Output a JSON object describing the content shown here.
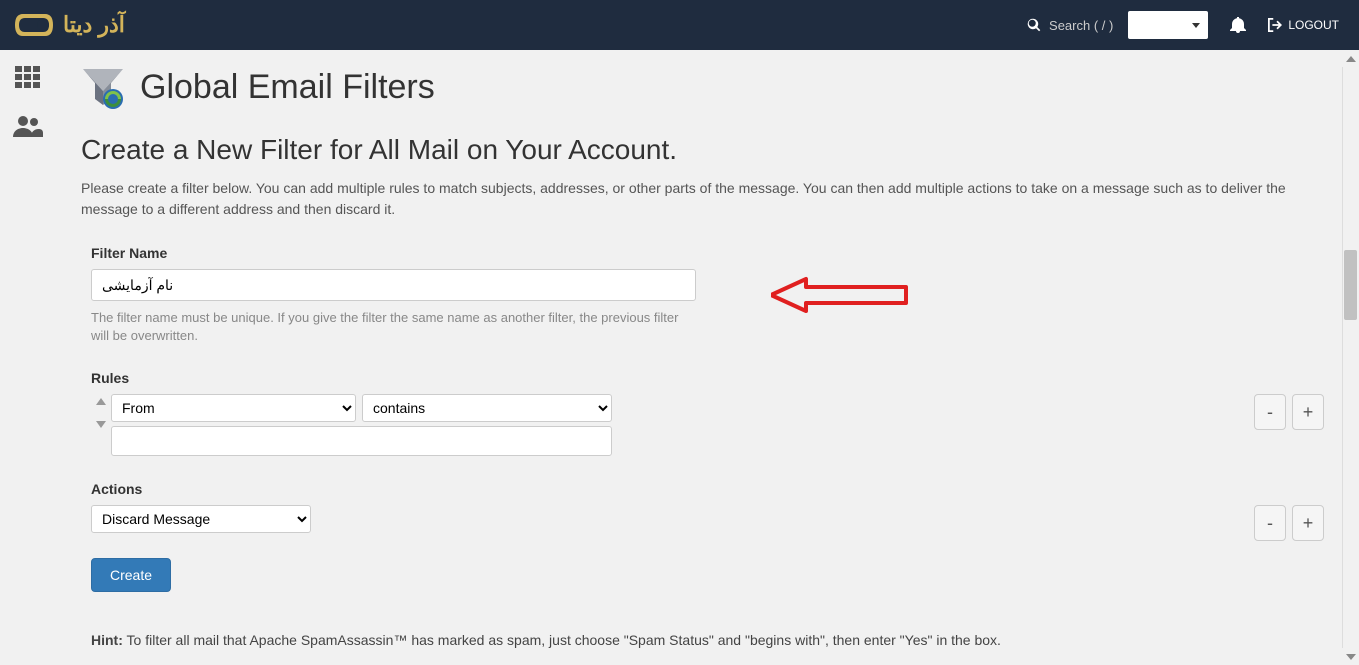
{
  "header": {
    "brand_text": "آذر دیتا",
    "search_placeholder": "Search  ( / )",
    "logout_label": "LOGOUT"
  },
  "page": {
    "title": "Global Email Filters",
    "subtitle": "Create a New Filter for All Mail on Your Account.",
    "description": "Please create a filter below. You can add multiple rules to match subjects, addresses, or other parts of the message. You can then add multiple actions to take on a message such as to deliver the message to a different address and then discard it."
  },
  "filter_name": {
    "label": "Filter Name",
    "value": "نام آزمایشی",
    "help": "The filter name must be unique. If you give the filter the same name as another filter, the previous filter will be overwritten."
  },
  "rules": {
    "label": "Rules",
    "field_select": "From",
    "match_select": "contains",
    "value": "",
    "minus": "-",
    "plus": "+"
  },
  "actions": {
    "label": "Actions",
    "select": "Discard Message",
    "minus": "-",
    "plus": "+"
  },
  "create_button": "Create",
  "hint": {
    "label": "Hint:",
    "text": " To filter all mail that Apache SpamAssassin™ has marked as spam, just choose \"Spam Status\" and \"begins with\", then enter \"Yes\" in the box."
  }
}
